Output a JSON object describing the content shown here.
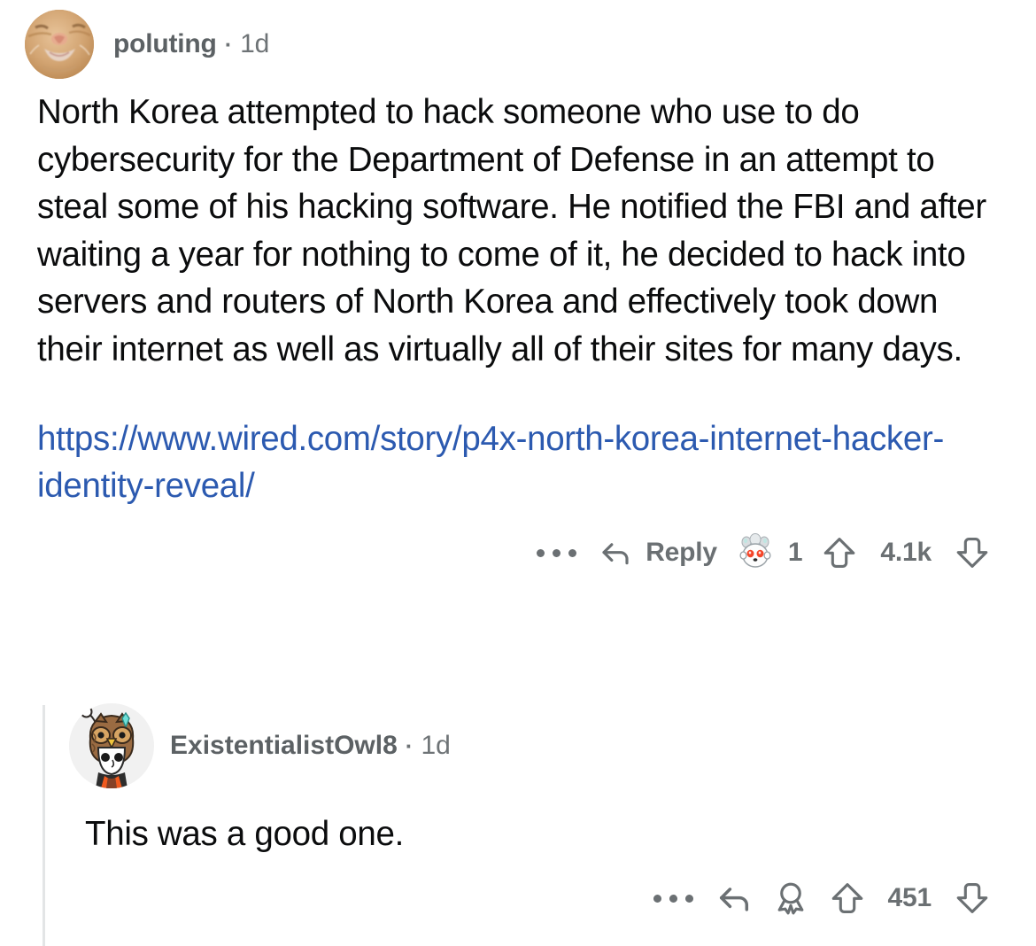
{
  "comment": {
    "author": "poluting",
    "separator": "·",
    "age": "1d",
    "avatar_icon": "cat-photo-avatar",
    "body": "North Korea attempted to hack someone who use to do cybersecurity for the Department of Defense in an attempt to steal some of his hacking software. He notified the FBI and after waiting a year for nothing to come of it, he decided to hack into servers and routers of North Korea and effectively took down their internet as well as virtually all of their sites for many days.",
    "link_text": "https://www.wired.com/story/p4x-north-korea-internet-hacker-identity-reveal/",
    "actions": {
      "overflow_icon": "ellipsis-icon",
      "reply_icon": "reply-arrow-icon",
      "reply_label": "Reply",
      "award_icon": "snoo-award-icon",
      "award_count": "1",
      "upvote_icon": "upvote-arrow-icon",
      "score": "4.1k",
      "downvote_icon": "downvote-arrow-icon"
    }
  },
  "reply": {
    "author": "ExistentialistOwl8",
    "separator": "·",
    "age": "1d",
    "avatar_icon": "snoo-owl-avatar",
    "body": "This was a good one.",
    "actions": {
      "overflow_icon": "ellipsis-icon",
      "reply_icon": "reply-arrow-icon",
      "award_icon": "award-medal-icon",
      "upvote_icon": "upvote-arrow-icon",
      "score": "451",
      "downvote_icon": "downvote-arrow-icon"
    }
  },
  "colors": {
    "link": "#2c5ab0",
    "meta_text": "#6e7376",
    "body_text": "#0b0c0d",
    "thread_line": "#e3e5e6"
  }
}
